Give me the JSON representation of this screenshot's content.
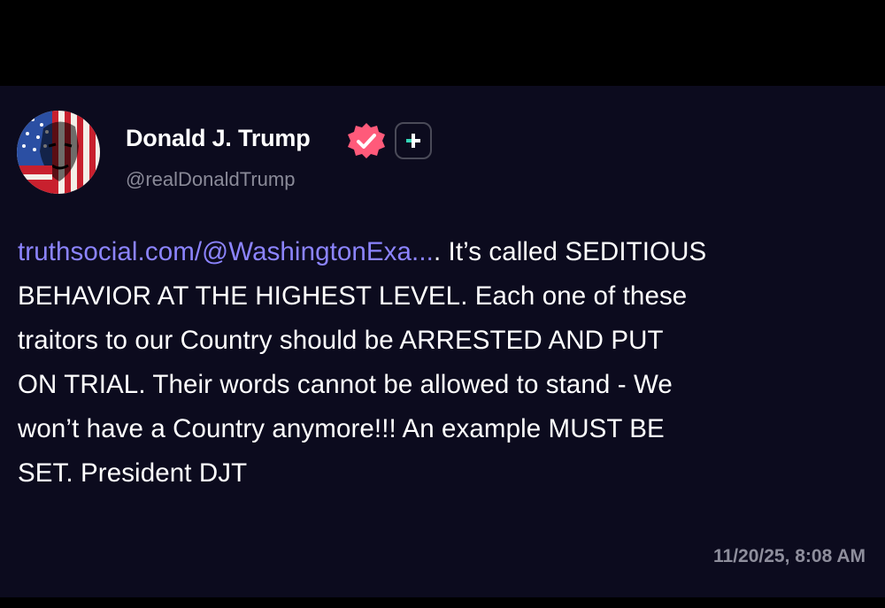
{
  "author": {
    "name": "Donald J. Trump",
    "handle": "@realDonaldTrump",
    "avatar_icon": "flag-portrait-avatar",
    "verified_icon": "verified-badge-icon",
    "verified_color": "#ff5a7a",
    "badge_icon": "plus-icon"
  },
  "post": {
    "link_text": "truthsocial.com/@WashingtonExa...",
    "line1_rest": ". It’s called SEDITIOUS",
    "line2": "BEHAVIOR AT THE HIGHEST LEVEL. Each one of these",
    "line3": "traitors to our Country should be ARRESTED AND PUT",
    "line4": "ON TRIAL. Their words cannot be allowed to stand - We",
    "line5": "won’t have a Country anymore!!! An example MUST BE",
    "line6": "SET. President DJT",
    "link_color": "#8c84ff",
    "timestamp": "11/20/25, 8:08 AM"
  },
  "theme": {
    "card_background": "#0c0b1e",
    "text_color": "#ffffff",
    "muted_color": "#8a8a98"
  }
}
